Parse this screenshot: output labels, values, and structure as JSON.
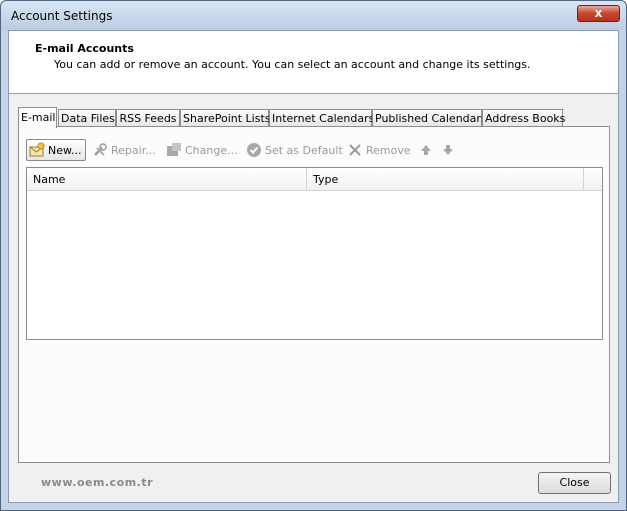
{
  "window": {
    "title": "Account Settings",
    "close_glyph": "x"
  },
  "header": {
    "title": "E-mail Accounts",
    "description": "You can add or remove an account. You can select an account and change its settings."
  },
  "tabs": [
    {
      "label": "E-mail",
      "active": true
    },
    {
      "label": "Data Files"
    },
    {
      "label": "RSS Feeds"
    },
    {
      "label": "SharePoint Lists"
    },
    {
      "label": "Internet Calendars"
    },
    {
      "label": "Published Calendars"
    },
    {
      "label": "Address Books"
    }
  ],
  "toolbar": {
    "new_label": "New...",
    "repair_label": "Repair...",
    "change_label": "Change...",
    "default_label": "Set as Default",
    "remove_label": "Remove",
    "icons": [
      "new-account-icon",
      "repair-icon",
      "change-icon",
      "set-default-icon",
      "remove-icon",
      "move-up-icon",
      "move-down-icon"
    ]
  },
  "list": {
    "columns": [
      "Name",
      "Type"
    ],
    "rows": []
  },
  "footer": {
    "watermark": "www.oem.com.tr",
    "close_label": "Close"
  },
  "colors": {
    "window_frame": "#c4d3e6",
    "close_red": "#c8452d",
    "disabled_text": "#9a9a9a"
  }
}
